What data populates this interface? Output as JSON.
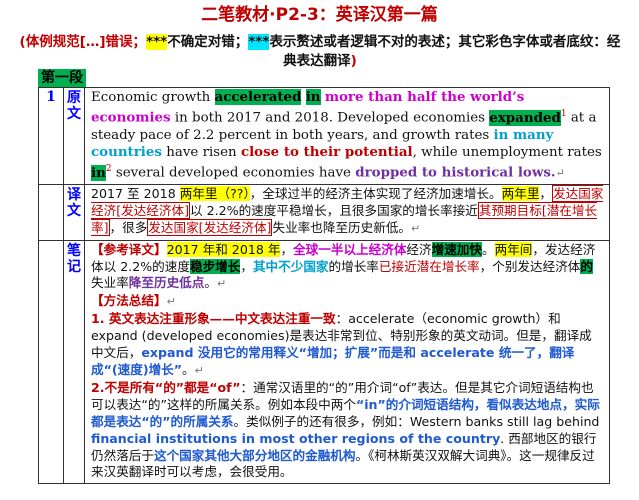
{
  "title": "二笔教材·P2-3：英译汉第一篇",
  "legend": {
    "p1": "(体例规范[…]错误；",
    "p2": "***",
    "p3": "不确定对错；",
    "p4": "***",
    "p5": "表示赘述或者逻辑不对的表述；其它彩色字体或者底纹：经典表达翻译",
    "p6": ")"
  },
  "section_tag": "第一段",
  "row_number": "1",
  "labels": {
    "original": "原文",
    "translation": "译文",
    "notes": "笔记"
  },
  "original": {
    "s1": "Economic growth ",
    "s2": "accelerated",
    "s3": " ",
    "s4": "in",
    "s5": " ",
    "s6": "more than half the world’s economies",
    "s7": " in both 2017 and 2018. Developed economies ",
    "s8": "expanded",
    "s9": "1",
    "s10": " at a steady pace of 2.2 percent in both years, and growth rates ",
    "s11": "in many countries",
    "s12": " have risen ",
    "s13": "close to their potential",
    "s14": ", while unemployment rates ",
    "s15": "in",
    "s16": "2",
    "s17": " several developed economies have ",
    "s18": "dropped to historical lows."
  },
  "translation": {
    "t1": "2017 至 2018 ",
    "t2": "两年里（??）",
    "t3": "，全球过半的经济主体实现了经济加速增长。",
    "t4": "两年里",
    "t5": "，",
    "t6": "发达国家经济[发达经济体]",
    "t7": "以 2.2%的速度平稳增长，且很多国家的增长率接近",
    "t8": "其预期目标[潜在增长率]",
    "t9": "，很多",
    "t10": "发达国家[发达经济体]",
    "t11": "失业率也降至历史新低。"
  },
  "notes": {
    "n1": "【参考译文】",
    "n2": "2017 年和 2018 年",
    "n3": "，",
    "n4": "全球一半以上经济体",
    "n5": "经济",
    "n6": "增速加快",
    "n7": "。",
    "n8": "两年间",
    "n9": "，发达经济体以 2.2%的速度",
    "n10": "稳步增长",
    "n11": "，",
    "n12": "其中不少国家",
    "n13": "的增长率",
    "n14": "已接近潜在增长率",
    "n15": "，个别发达经济体",
    "n16": "的",
    "n17": "失业率",
    "n18": "降至历史低点",
    "n19": "。",
    "n20": "【方法总结】",
    "n21": "1. 英文表达注重形象——中文表达注重一致",
    "n22": "：accelerate（economic growth）和 expand (developed economies)是表达非常到位、特别形象的英文动词。但是，翻译成中文后，",
    "n23": "expand 没用它的常用释义“增加；扩展”而是和 accelerate 统一了，翻译成“(速度)增长”",
    "n24": "。",
    "n25": "2.不是所有“的”都是“of”",
    "n26": "：通常汉语里的“的”用介词“of”表达。但是其它介词短语结构也可以表达“的”这样的所属关系。例如本段中两个",
    "n27": "“in”的介词短语结构，看似表达地点，实际都是表达“的”的所属关系",
    "n28": "。类似例子的还有很多，例如：Western banks still lag behind ",
    "n29": "financial institutions in most other regions of the country",
    "n30": ". 西部地区的银行仍然落后于",
    "n31": "这个国家其他大部分地区的金融机构",
    "n32": "。《柯林斯英汉双解大词典》。这一规律反过来汉英翻译时可以考虑，会很受用。"
  }
}
